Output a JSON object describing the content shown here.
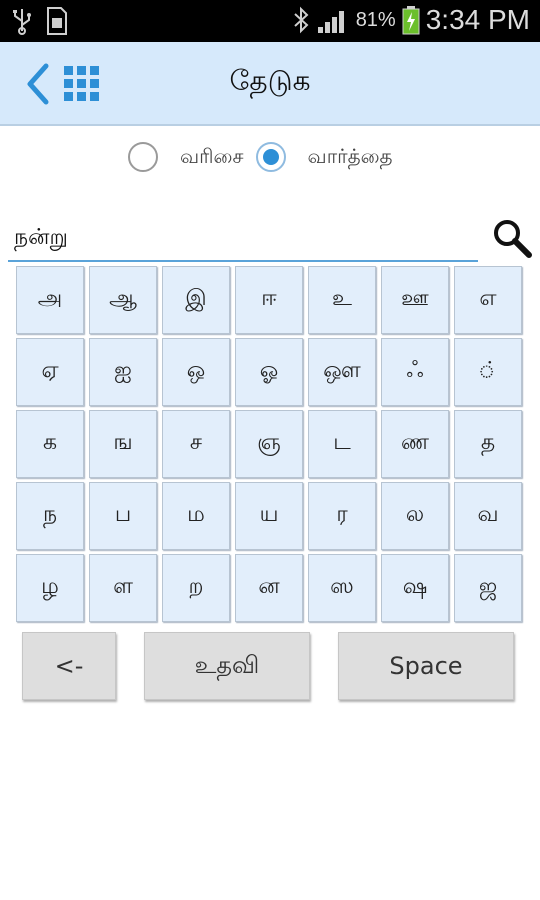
{
  "statusbar": {
    "battery_percent": "81%",
    "time": "3:34 PM",
    "icons": [
      "usb-icon",
      "sim-card-icon",
      "bluetooth-icon",
      "signal-icon",
      "battery-charging-icon"
    ]
  },
  "header": {
    "title": "தேடுக",
    "back_icon": "chevron-left-icon",
    "apps_icon": "grid-icon",
    "accent_color": "#2d8fd6"
  },
  "search_mode": {
    "options": [
      {
        "label": "வரிசை",
        "selected": false
      },
      {
        "label": "வார்த்தை",
        "selected": true
      }
    ]
  },
  "search": {
    "value": "நன்று",
    "icon": "search-icon"
  },
  "keyboard": {
    "keys": [
      "அ",
      "ஆ",
      "இ",
      "ஈ",
      "உ",
      "ஊ",
      "எ",
      "ஏ",
      "ஐ",
      "ஒ",
      "ஓ",
      "ஔ",
      "ஃ",
      "்",
      "க",
      "ங",
      "ச",
      "ஞ",
      "ட",
      "ண",
      "த",
      "ந",
      "ப",
      "ம",
      "ய",
      "ர",
      "ல",
      "வ",
      "ழ",
      "ள",
      "ற",
      "ன",
      "ஸ",
      "ஷ",
      "ஜ"
    ]
  },
  "buttons": {
    "backspace": "<-",
    "help": "உதவி",
    "space": "Space"
  }
}
